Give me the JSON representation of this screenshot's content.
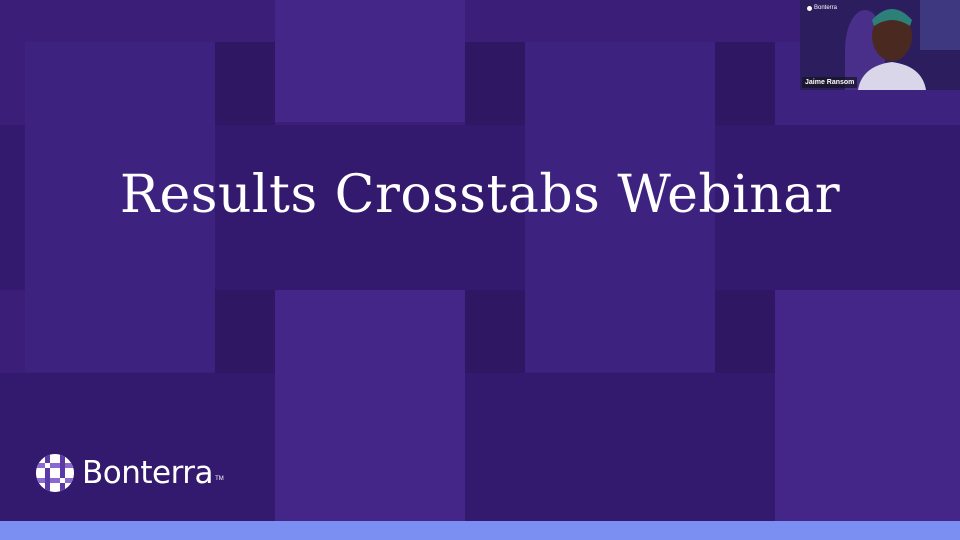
{
  "slide": {
    "title": "Results Crosstabs Webinar"
  },
  "brand": {
    "name": "Bonterra",
    "trademark": "TM",
    "logo_icon": "bonterra-woven-circle-icon"
  },
  "webcam": {
    "participant_name": "Jaime Ransom",
    "brand_name": "Bonterra"
  },
  "colors": {
    "background": "#3a1e78",
    "bottom_bar": "#7b8ef2",
    "text": "#ffffff"
  }
}
